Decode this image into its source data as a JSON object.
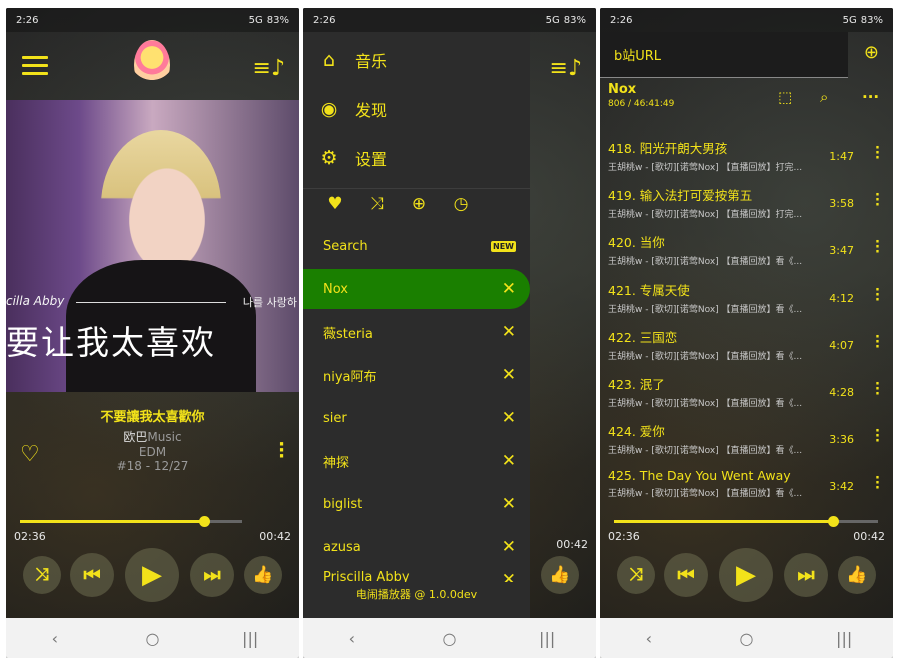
{
  "status": {
    "time": "2:26",
    "signal": "5G",
    "battery": "83%"
  },
  "nav": {
    "back": "‹",
    "home": "○",
    "recents": "|||"
  },
  "player": {
    "cover_artist_tag": "cilla Abby",
    "cover_korean": "나를 사랑하",
    "cover_title_art": "要让我太喜欢",
    "title": "不要讓我太喜歡你",
    "artist": "欧巴",
    "artist_suffix": "Music",
    "genre": "EDM",
    "track_position": "#18 - 12/27",
    "elapsed": "02:36",
    "remaining": "00:42",
    "progress_fraction": 0.83
  },
  "drawer": {
    "menu": [
      {
        "label": "音乐",
        "icon": "home-icon"
      },
      {
        "label": "发现",
        "icon": "compass-icon"
      },
      {
        "label": "设置",
        "icon": "gear-icon"
      }
    ],
    "quick_icons": [
      "heart-icon",
      "shuffle-icon",
      "add-circle-icon",
      "timer-icon"
    ],
    "search_label": "Search",
    "new_badge": "NEW",
    "playlists": [
      {
        "label": "Nox",
        "active": true
      },
      {
        "label": "薇steria",
        "active": false
      },
      {
        "label": "niya阿布",
        "active": false
      },
      {
        "label": "sier",
        "active": false
      },
      {
        "label": "神探",
        "active": false
      },
      {
        "label": "biglist",
        "active": false
      },
      {
        "label": "azusa",
        "active": false
      },
      {
        "label": "Priscilla Abby",
        "active": false
      }
    ],
    "version": "电闹播放器 @ 1.0.0dev",
    "accent": "#f2e21a",
    "active_color": "#1a7f00"
  },
  "list": {
    "url_placeholder": "b站URL",
    "playlist_name": "Nox",
    "count_duration": "806 / 46:41:49",
    "items": [
      {
        "title": "418. 阳光开朗大男孩",
        "sub": "王胡桃w - [歌切][诺莺Nox] 【直播回放】打完...",
        "dur": "1:47"
      },
      {
        "title": "419. 输入法打可爱按第五",
        "sub": "王胡桃w - [歌切][诺莺Nox] 【直播回放】打完...",
        "dur": "3:58"
      },
      {
        "title": "420. 当你",
        "sub": "王胡桃w - [歌切][诺莺Nox] 【直播回放】看《...",
        "dur": "3:47"
      },
      {
        "title": "421. 专属天使",
        "sub": "王胡桃w - [歌切][诺莺Nox] 【直播回放】看《...",
        "dur": "4:12"
      },
      {
        "title": "422. 三国恋",
        "sub": "王胡桃w - [歌切][诺莺Nox] 【直播回放】看《...",
        "dur": "4:07"
      },
      {
        "title": "423. 泯了",
        "sub": "王胡桃w - [歌切][诺莺Nox] 【直播回放】看《...",
        "dur": "4:28"
      },
      {
        "title": "424. 爱你",
        "sub": "王胡桃w - [歌切][诺莺Nox] 【直播回放】看《...",
        "dur": "3:36"
      },
      {
        "title": "425. The Day You Went Away",
        "sub": "王胡桃w - [歌切][诺莺Nox] 【直播回放】看《...",
        "dur": "3:42"
      }
    ]
  }
}
